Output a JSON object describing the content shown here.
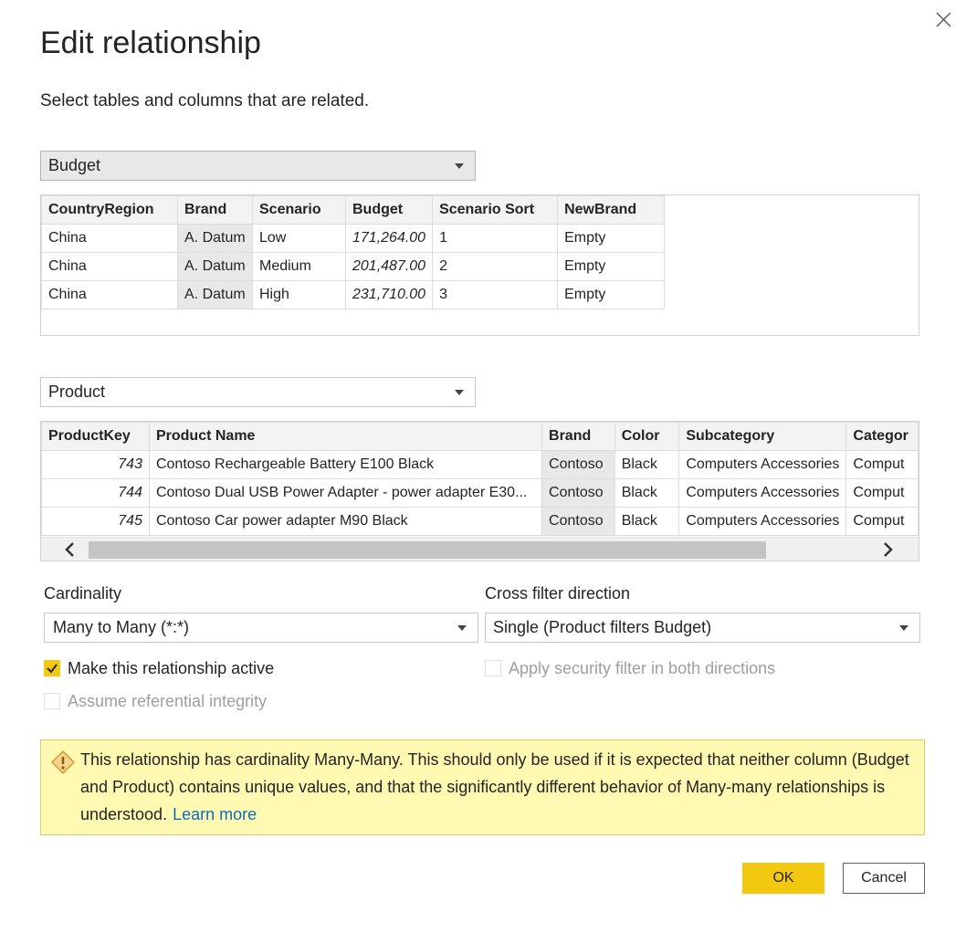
{
  "dialog": {
    "title": "Edit relationship",
    "subtitle": "Select tables and columns that are related.",
    "close_icon": "close-icon"
  },
  "table1": {
    "selected": "Budget",
    "columns": [
      "CountryRegion",
      "Brand",
      "Scenario",
      "Budget",
      "Scenario Sort",
      "NewBrand"
    ],
    "rows": [
      [
        "China",
        "A. Datum",
        "Low",
        "171,264.00",
        "1",
        "Empty"
      ],
      [
        "China",
        "A. Datum",
        "Medium",
        "201,487.00",
        "2",
        "Empty"
      ],
      [
        "China",
        "A. Datum",
        "High",
        "231,710.00",
        "3",
        "Empty"
      ]
    ]
  },
  "table2": {
    "selected": "Product",
    "columns": [
      "ProductKey",
      "Product Name",
      "Brand",
      "Color",
      "Subcategory",
      "Categor"
    ],
    "rows": [
      [
        "743",
        "Contoso Rechargeable Battery E100 Black",
        "Contoso",
        "Black",
        "Computers Accessories",
        "Comput"
      ],
      [
        "744",
        "Contoso Dual USB Power Adapter - power adapter E30...",
        "Contoso",
        "Black",
        "Computers Accessories",
        "Comput"
      ],
      [
        "745",
        "Contoso Car power adapter M90 Black",
        "Contoso",
        "Black",
        "Computers Accessories",
        "Comput"
      ]
    ]
  },
  "cardinality": {
    "label": "Cardinality",
    "value": "Many to Many (*:*)"
  },
  "cross_filter": {
    "label": "Cross filter direction",
    "value": "Single (Product filters Budget)"
  },
  "options": {
    "active_label": "Make this relationship active",
    "active_checked": true,
    "security_label": "Apply security filter in both directions",
    "security_checked": false,
    "integrity_label": "Assume referential integrity",
    "integrity_checked": false
  },
  "warning": {
    "text": "This relationship has cardinality Many-Many. This should only be used if it is expected that neither column (Budget and Product) contains unique values, and that the significantly different behavior of Many-many relationships is understood.",
    "link": "Learn more"
  },
  "buttons": {
    "ok": "OK",
    "cancel": "Cancel"
  },
  "colors": {
    "accent": "#f2c811",
    "warning_bg": "#fff9b1",
    "link": "#0f6cbd"
  }
}
